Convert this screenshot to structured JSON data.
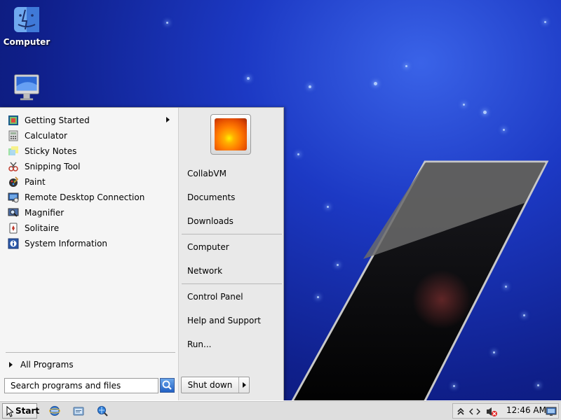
{
  "desktop": {
    "icons": [
      {
        "label": "Computer",
        "icon": "finder-face-icon"
      },
      {
        "label": "",
        "icon": "imac-monitor-icon"
      }
    ]
  },
  "start_menu": {
    "programs": [
      {
        "label": "Getting Started",
        "icon": "getting-started-icon",
        "submenu": true
      },
      {
        "label": "Calculator",
        "icon": "calculator-icon"
      },
      {
        "label": "Sticky Notes",
        "icon": "sticky-notes-icon"
      },
      {
        "label": "Snipping Tool",
        "icon": "snipping-tool-icon"
      },
      {
        "label": "Paint",
        "icon": "paint-icon"
      },
      {
        "label": "Remote Desktop Connection",
        "icon": "remote-desktop-icon"
      },
      {
        "label": "Magnifier",
        "icon": "magnifier-icon"
      },
      {
        "label": "Solitaire",
        "icon": "solitaire-icon"
      },
      {
        "label": "System Information",
        "icon": "system-information-icon"
      }
    ],
    "all_programs": "All Programs",
    "search_placeholder": "Search programs and files",
    "right_items": {
      "user": "CollabVM",
      "documents": "Documents",
      "downloads": "Downloads",
      "computer": "Computer",
      "network": "Network",
      "control_panel": "Control Panel",
      "help": "Help and Support",
      "run": "Run..."
    },
    "shutdown_label": "Shut down"
  },
  "taskbar": {
    "start_label": "Start",
    "pinned": [
      "internet-explorer-icon",
      "explorer-folder-icon",
      "search-globe-icon"
    ],
    "tray_icons": [
      "show-hidden-icons-icon",
      "network-arrows-icon",
      "volume-muted-icon",
      "display-icon"
    ],
    "clock": "12:46 AM"
  },
  "colors": {
    "desktop_blue": "#1c39c4",
    "menu_bg": "#f0f0f0",
    "taskbar_bg": "#dedede"
  }
}
